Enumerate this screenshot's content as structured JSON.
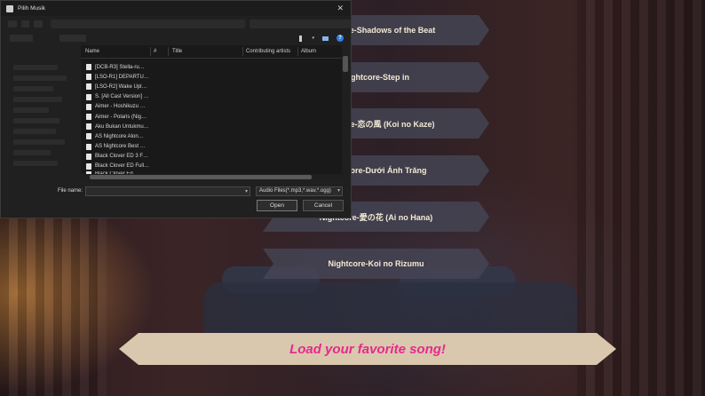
{
  "dialog": {
    "title": "Pilih Musik",
    "close_glyph": "✕",
    "columns": [
      "Name",
      "#",
      "Title",
      "Contributing artists",
      "Album"
    ],
    "files": [
      "[DCB-R3] Stella-ru…",
      "[LSO-R1] DEPARTU…",
      "[LSO-R2] Wake Upl…",
      "S. [All Cast Version] …",
      "Aimer - Hoshikuzu …",
      "Aimer - Polaris (Nig…",
      "Aku Bukan Untukmu…",
      "AS  Nightcore Alon…",
      "AS  Nightcore Best …",
      "Black Clover ED 3 F…",
      "Black Clover ED Full…",
      "Black Clover Ed…"
    ],
    "filename_label": "File name:",
    "filename_value": "",
    "filetype": "Audio Files(*.mp3,*.wav,*.ogg)",
    "open_label": "Open",
    "cancel_label": "Cancel",
    "help_glyph": "?"
  },
  "songs": [
    "Nightcore-Shadows of the Beat",
    "Nightcore-Step in",
    "Nightcore-恋の風 (Koi no Kaze)",
    "Nightcore-Dưới Ánh Trăng",
    "Nightcore-愛の花 (Ai no Hana)",
    "Nightcore-Koi no Rizumu"
  ],
  "banner": "Load your favorite song!",
  "colors": {
    "banner_text": "#e8288e",
    "banner_bg": "#d9c8ad",
    "help_icon": "#2f7fe0"
  }
}
